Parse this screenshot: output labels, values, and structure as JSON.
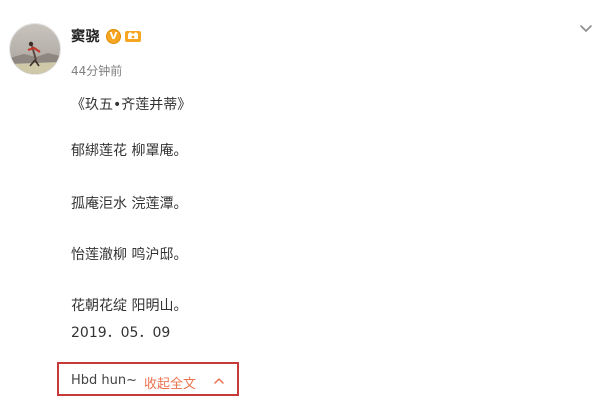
{
  "post": {
    "author": {
      "name": "窦骁",
      "verified_badge": "V",
      "verified_icon": "verified-v-icon",
      "fan_badge_icon": "fan-badge-icon",
      "avatar_icon": "avatar-photo"
    },
    "timestamp": "44分钟前",
    "menu_icon": "chevron-down-icon",
    "content_lines": [
      "《玖五•齐莲并蒂》",
      "郁綁莲花 柳罩庵。",
      "孤庵洰水 浣莲潭。",
      "怡莲澈柳 鸣沪邸。",
      "花朝花绽 阳明山。",
      "2019．05．09"
    ],
    "footer": {
      "prefix": "Hbd hun~",
      "collapse_label": "收起全文",
      "collapse_icon": "chevron-up-icon"
    }
  },
  "colors": {
    "link": "#eb7350",
    "highlight_box": "#c83a3a",
    "badge": "#f7a623",
    "muted": "#808080"
  }
}
